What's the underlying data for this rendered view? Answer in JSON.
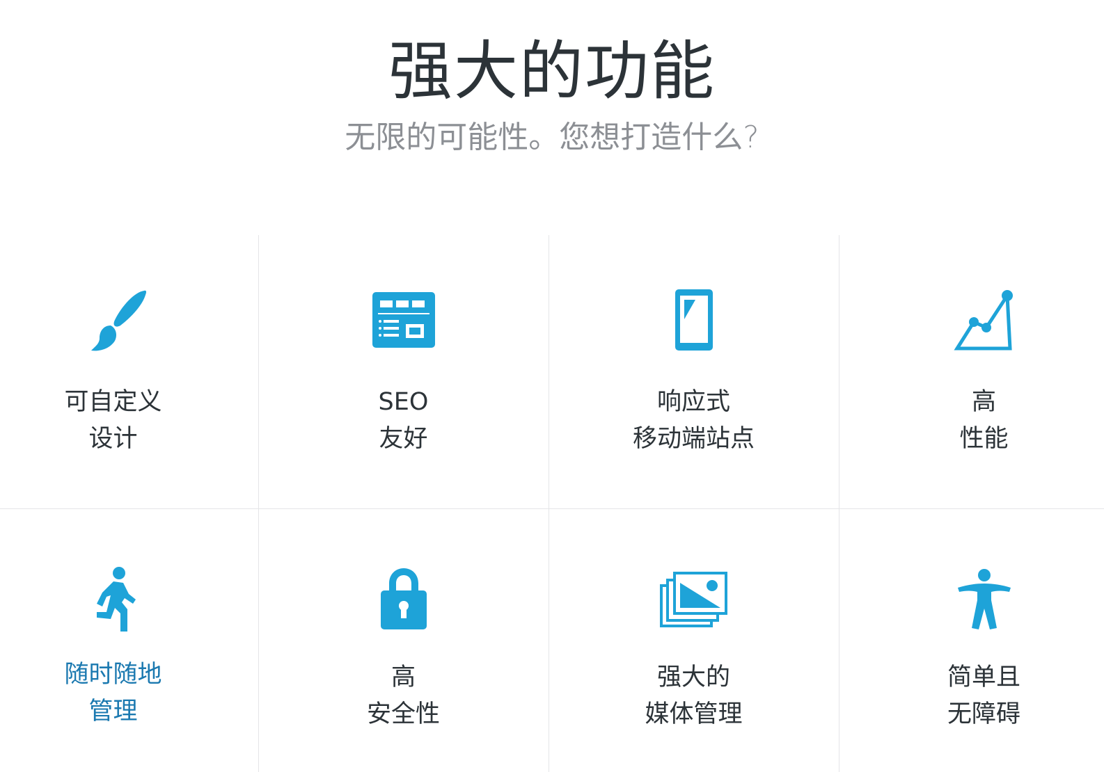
{
  "header": {
    "title": "强大的功能",
    "subtitle": "无限的可能性。您想打造什么?"
  },
  "colors": {
    "icon": "#1ea3d8",
    "active_label": "#1b79b0",
    "label": "#2c3338",
    "divider": "#e4e5e7"
  },
  "features": [
    {
      "icon": "paintbrush-icon",
      "line1": "可自定义",
      "line2": "设计"
    },
    {
      "icon": "layout-icon",
      "line1": "SEO",
      "line2": "友好"
    },
    {
      "icon": "mobile-phone-icon",
      "line1": "响应式",
      "line2": "移动端站点"
    },
    {
      "icon": "chart-line-icon",
      "line1": "高",
      "line2": "性能"
    },
    {
      "icon": "running-person-icon",
      "line1": "随时随地",
      "line2": "管理"
    },
    {
      "icon": "padlock-icon",
      "line1": "高",
      "line2": "安全性"
    },
    {
      "icon": "image-gallery-icon",
      "line1": "强大的",
      "line2": "媒体管理"
    },
    {
      "icon": "accessibility-icon",
      "line1": "简单且",
      "line2": "无障碍"
    }
  ]
}
